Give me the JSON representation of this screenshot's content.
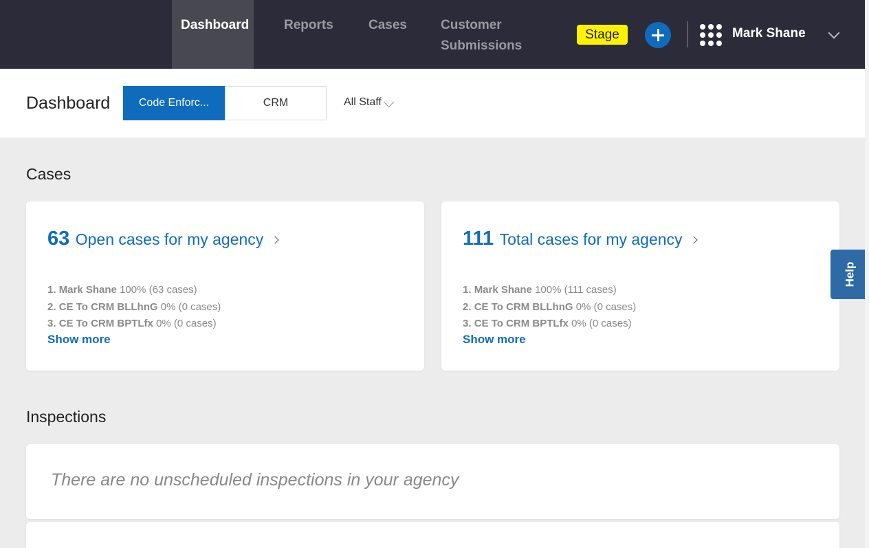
{
  "nav": {
    "tabs": [
      {
        "label": "Dashboard"
      },
      {
        "label": "Reports"
      },
      {
        "label": "Cases"
      },
      {
        "label": "Customer Submissions"
      }
    ],
    "env_badge": "Stage",
    "user_name": "Mark Shane",
    "add_icon": "plus-circle-icon",
    "apps_icon": "grid-icon",
    "menu_icon": "chevron-down-icon"
  },
  "header": {
    "title": "Dashboard",
    "segments": [
      {
        "label": "Code Enforc...",
        "selected": true
      },
      {
        "label": "CRM",
        "selected": false
      }
    ],
    "staff_filter": "All Staff"
  },
  "cases": {
    "section_title": "Cases",
    "cards": [
      {
        "count": "63",
        "title": "Open cases for my agency",
        "rows": [
          {
            "rank": "1.",
            "name": "Mark Shane",
            "stat": "100% (63 cases)"
          },
          {
            "rank": "2.",
            "name": "CE To CRM BLLhnG",
            "stat": "0% (0 cases)"
          },
          {
            "rank": "3.",
            "name": "CE To CRM BPTLfx",
            "stat": "0% (0 cases)"
          }
        ],
        "show_more": "Show more"
      },
      {
        "count": "111",
        "title": "Total cases for my agency",
        "rows": [
          {
            "rank": "1.",
            "name": "Mark Shane",
            "stat": "100% (111 cases)"
          },
          {
            "rank": "2.",
            "name": "CE To CRM BLLhnG",
            "stat": "0% (0 cases)"
          },
          {
            "rank": "3.",
            "name": "CE To CRM BPTLfx",
            "stat": "0% (0 cases)"
          }
        ],
        "show_more": "Show more"
      }
    ]
  },
  "inspections": {
    "section_title": "Inspections",
    "empty_message": "There are no unscheduled inspections in your agency"
  },
  "help": {
    "label": "Help"
  },
  "colors": {
    "nav_bg": "#2b2b39",
    "accent": "#0f6cbd",
    "badge": "#fff200",
    "help_bg": "#2e6aa5"
  }
}
